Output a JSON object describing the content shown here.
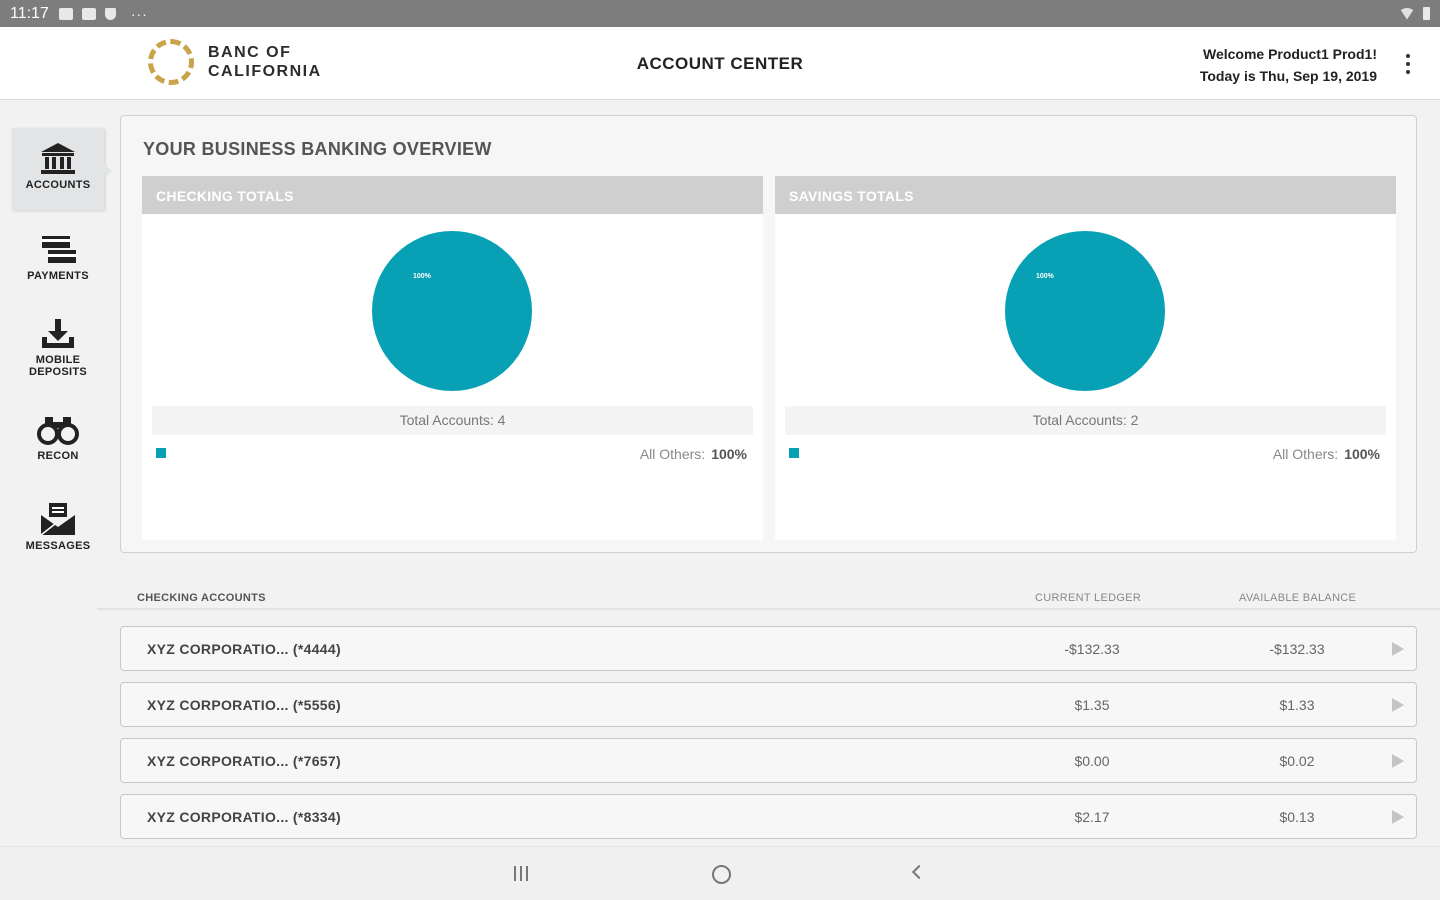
{
  "status_bar": {
    "time": "11:17",
    "overflow": "···"
  },
  "header": {
    "logo_line1": "BANC OF",
    "logo_line2": "CALIFORNIA",
    "title": "ACCOUNT CENTER",
    "welcome": "Welcome Product1 Prod1!",
    "date": "Today is Thu, Sep 19, 2019"
  },
  "sidebar": {
    "items": [
      {
        "label": "ACCOUNTS",
        "icon": "bank-icon"
      },
      {
        "label": "PAYMENTS",
        "icon": "payments-icon"
      },
      {
        "label": "MOBILE",
        "label2": "DEPOSITS",
        "icon": "download-icon"
      },
      {
        "label": "RECON",
        "icon": "binoculars-icon"
      },
      {
        "label": "MESSAGES",
        "icon": "envelope-icon"
      }
    ]
  },
  "overview": {
    "title": "YOUR BUSINESS BANKING OVERVIEW",
    "checking": {
      "header": "CHECKING TOTALS",
      "pie_label": "100%",
      "total_accounts": "Total Accounts: 4",
      "legend_label": "All Others:",
      "legend_value": "100%"
    },
    "savings": {
      "header": "SAVINGS TOTALS",
      "pie_label": "100%",
      "total_accounts": "Total Accounts: 2",
      "legend_label": "All Others:",
      "legend_value": "100%"
    }
  },
  "accounts": {
    "header_name": "CHECKING ACCOUNTS",
    "header_ledger": "CURRENT LEDGER",
    "header_available": "AVAILABLE BALANCE",
    "rows": [
      {
        "name": "XYZ CORPORATIO... (*4444)",
        "ledger": "-$132.33",
        "available": "-$132.33"
      },
      {
        "name": "XYZ CORPORATIO... (*5556)",
        "ledger": "$1.35",
        "available": "$1.33"
      },
      {
        "name": "XYZ CORPORATIO... (*7657)",
        "ledger": "$0.00",
        "available": "$0.02"
      },
      {
        "name": "XYZ CORPORATIO... (*8334)",
        "ledger": "$2.17",
        "available": "$0.13"
      }
    ]
  },
  "colors": {
    "teal": "#08a0b4",
    "gold": "#c9a44a",
    "gray_header": "#cfcfcf"
  }
}
